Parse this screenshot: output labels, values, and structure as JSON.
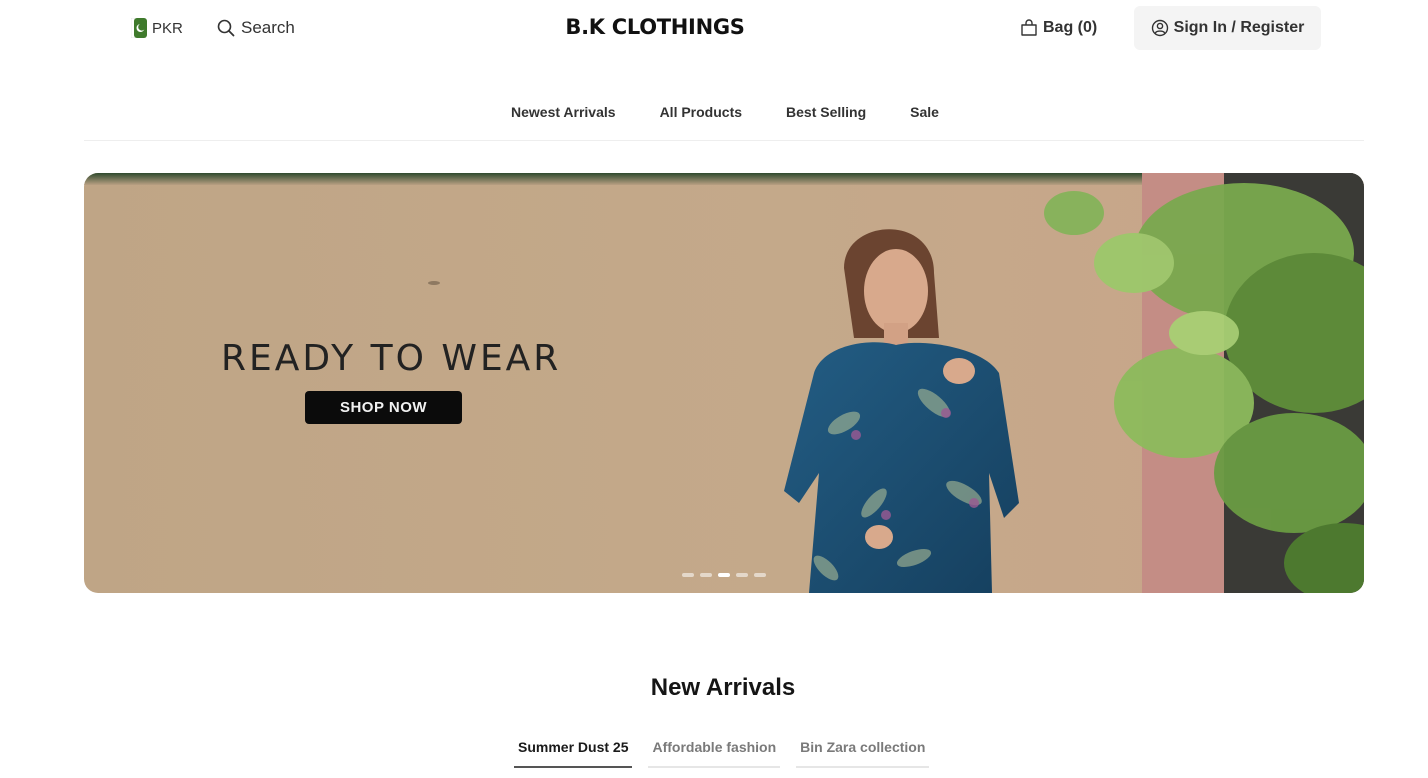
{
  "header": {
    "currency": "PKR",
    "search_label": "Search",
    "brand": "B.K CLOTHINGS",
    "bag_label": "Bag (0)",
    "signin_label": "Sign In / Register"
  },
  "nav": {
    "items": [
      {
        "label": "Newest Arrivals"
      },
      {
        "label": "All Products"
      },
      {
        "label": "Best Selling"
      },
      {
        "label": "Sale"
      }
    ]
  },
  "hero": {
    "headline": "READY TO WEAR",
    "cta": "SHOP NOW",
    "slide_count": 5,
    "active_slide": 3
  },
  "new_arrivals": {
    "title": "New Arrivals",
    "tabs": [
      {
        "label": "Summer Dust 25",
        "active": true
      },
      {
        "label": "Affordable fashion",
        "active": false
      },
      {
        "label": "Bin Zara collection",
        "active": false
      }
    ]
  },
  "icons": {
    "flag": "pakistan-flag-icon",
    "search": "search-icon",
    "bag": "shopping-bag-icon",
    "user": "user-circle-icon"
  },
  "colors": {
    "flag_green": "#01411c",
    "cta_background": "#0b0b0b",
    "wall": "#c2a887",
    "dress_blue": "#1c4f73"
  }
}
